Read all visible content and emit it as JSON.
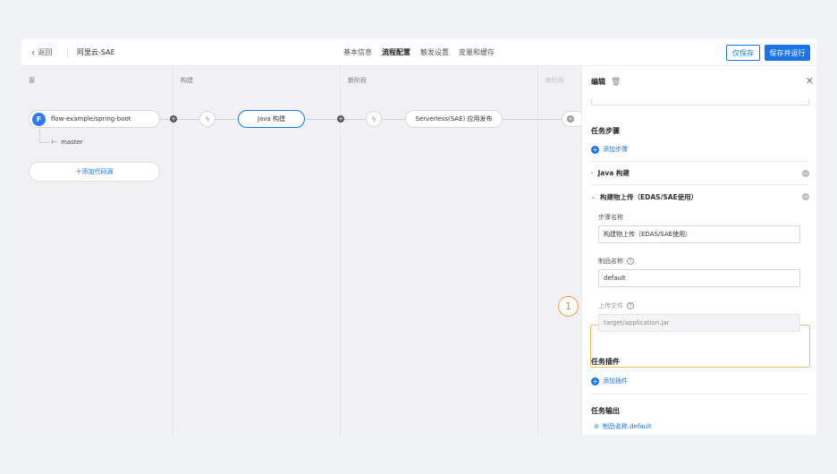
{
  "header": {
    "back_label": "返回",
    "app_title": "阿里云-SAE",
    "tabs": [
      "基本信息",
      "流程配置",
      "触发设置",
      "变量和缓存"
    ],
    "save_label": "仅保存",
    "save_run_label": "保存并运行"
  },
  "canvas": {
    "columns": [
      "源",
      "构建",
      "新阶段",
      "新阶段"
    ],
    "source": {
      "repo": "flow-example/spring-boot",
      "branch": "master",
      "add_source_label": "十添加代码源"
    },
    "build_task": "Java 构建",
    "deploy_task": "Serverless(SAE) 应用发布"
  },
  "panel": {
    "title": "编辑",
    "task_steps_title": "任务步骤",
    "add_step_label": "添加步骤",
    "steps": [
      {
        "label": "Java 构建",
        "expanded": false
      },
      {
        "label": "构建物上传（EDAS/SAE使用）",
        "expanded": true
      }
    ],
    "step_name_label": "步骤名称",
    "step_name_value": "构建物上传（EDAS/SAE使用）",
    "artifact_name_label": "制品名称",
    "artifact_name_value": "default",
    "upload_file_label": "上传文件",
    "upload_file_value": "target/application.jar",
    "plugins_title": "任务插件",
    "add_plugin_label": "添加插件",
    "outputs_title": "任务输出",
    "output_value": "制品名称.default"
  },
  "callout_number": "1",
  "colors": {
    "primary": "#1b73e8",
    "highlight": "#f0b86a",
    "canvas_bg": "#f1f1f3"
  }
}
